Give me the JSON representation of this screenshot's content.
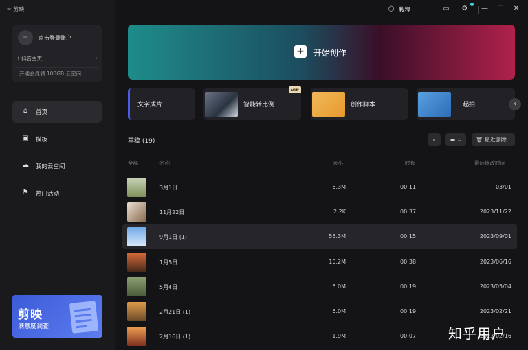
{
  "app": {
    "logo": "剪映"
  },
  "titlebar": {
    "tutorial_label": "教程",
    "minimize": "—",
    "maximize": "☐",
    "close": "✕"
  },
  "sidebar": {
    "login_text": "点击登录账户",
    "douyin_label": "抖音主页",
    "vip_text": "开通会员领 100GB 云空间",
    "nav": [
      {
        "label": "首页",
        "icon": "home-icon"
      },
      {
        "label": "模板",
        "icon": "template-icon"
      },
      {
        "label": "我的云空间",
        "icon": "cloud-icon"
      },
      {
        "label": "热门活动",
        "icon": "flag-icon"
      }
    ],
    "banner": {
      "title": "剪映",
      "subtitle": "满意度调查"
    }
  },
  "main": {
    "create_label": "开始创作",
    "quick": [
      {
        "label": "文字成片"
      },
      {
        "label": "智能转比例",
        "badge": "VIP"
      },
      {
        "label": "创作脚本"
      },
      {
        "label": "一起拍"
      }
    ],
    "drafts": {
      "title": "草稿 (19)",
      "clear_label": "最近删除",
      "columns": {
        "all": "全部",
        "name": "名称",
        "size": "大小",
        "duration": "时长",
        "modified": "最后修改时间"
      },
      "rows": [
        {
          "name": "3月1日",
          "size": "6.3M",
          "duration": "00:11",
          "modified": "03/01"
        },
        {
          "name": "11月22日",
          "size": "2.2K",
          "duration": "00:37",
          "modified": "2023/11/22"
        },
        {
          "name": "9月1日 (1)",
          "size": "55.3M",
          "duration": "00:15",
          "modified": "2023/09/01"
        },
        {
          "name": "1月5日",
          "size": "10.2M",
          "duration": "00:38",
          "modified": "2023/06/16"
        },
        {
          "name": "5月4日",
          "size": "6.0M",
          "duration": "00:19",
          "modified": "2023/05/04"
        },
        {
          "name": "2月21日 (1)",
          "size": "6.0M",
          "duration": "00:19",
          "modified": "2023/02/21"
        },
        {
          "name": "2月16日 (1)",
          "size": "1.9M",
          "duration": "00:07",
          "modified": "2023/02/16"
        }
      ]
    }
  },
  "watermark": "知乎用户",
  "colors": {
    "accent": "#4a5ce6",
    "background": "#141416",
    "sidebar": "#1a1a1d"
  }
}
